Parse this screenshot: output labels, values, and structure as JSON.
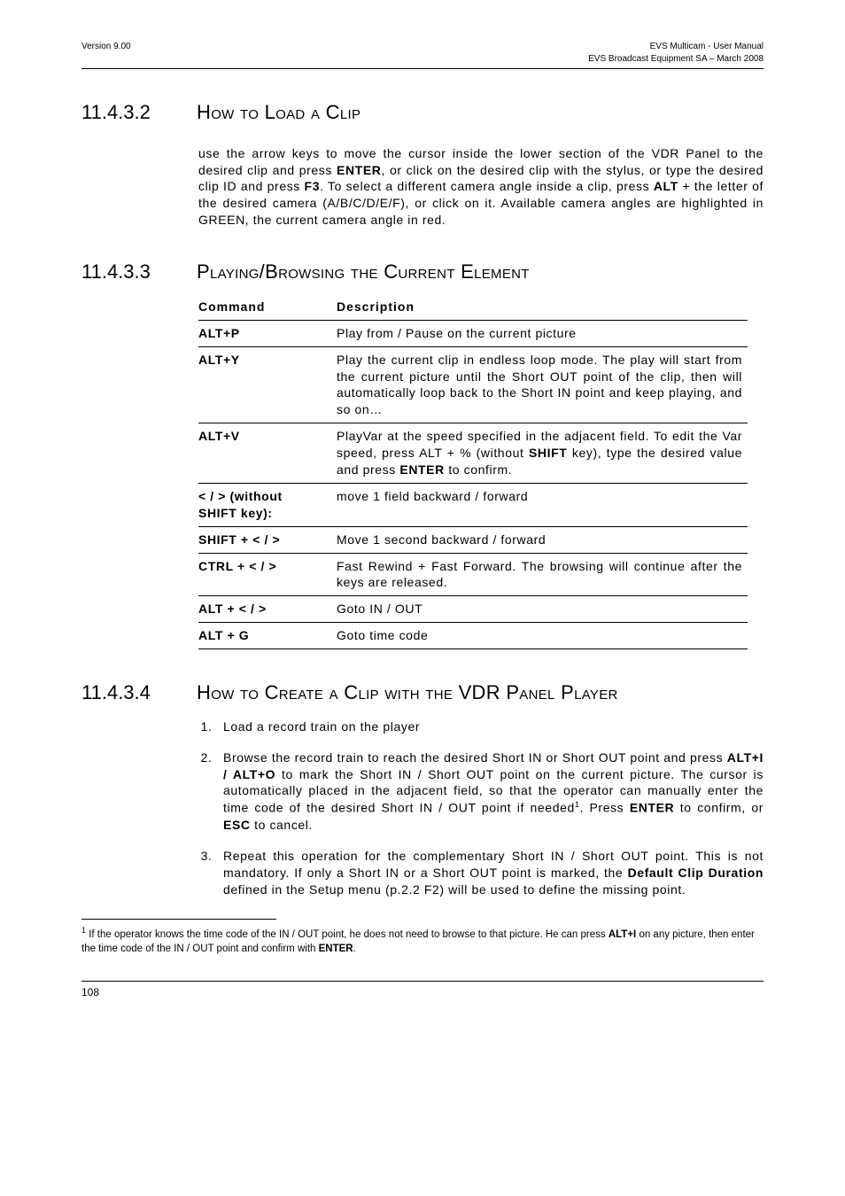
{
  "header": {
    "left": "Version 9.00",
    "right1": "EVS Multicam - User Manual",
    "right2": "EVS Broadcast Equipment SA – March 2008"
  },
  "s1": {
    "num": "11.4.3.2",
    "title": "How to Load a Clip",
    "p1_a": "use the arrow keys to move the cursor inside the lower section of the VDR Panel to the desired clip and press ",
    "p1_b": "ENTER",
    "p1_c": ", or click on the desired clip with the stylus, or type the desired clip ID and press ",
    "p1_d": "F3",
    "p1_e": ". To select a different camera angle inside a clip, press ",
    "p1_f": "ALT",
    "p1_g": " + the letter of the desired camera (A/B/C/D/E/F), or click on it. Available camera angles are highlighted in GREEN, the current camera angle in red."
  },
  "s2": {
    "num": "11.4.3.3",
    "title": "Playing/Browsing the Current Element",
    "th1": "Command",
    "th2": "Description",
    "r1k": "ALT+P",
    "r1v": "Play from / Pause on the current picture",
    "r2k": "ALT+Y",
    "r2v": "Play the current clip in endless loop mode. The play will start from the current picture until the Short OUT point of the clip, then will automatically loop back to the Short IN point and keep playing, and so on…",
    "r3k": "ALT+V",
    "r3v_a": "PlayVar at the speed specified in the adjacent field. To edit the Var speed, press ALT + % (without ",
    "r3v_b": "SHIFT",
    "r3v_c": " key), type the desired value and press ",
    "r3v_d": "ENTER",
    "r3v_e": " to confirm.",
    "r4k": "< / > (without\nSHIFT key):",
    "r4v": "move 1 field backward / forward",
    "r5k": "SHIFT + < / >",
    "r5v": "Move 1 second backward / forward",
    "r6k": "CTRL + < / >",
    "r6v": "Fast Rewind + Fast Forward. The browsing will continue after the keys are released.",
    "r7k": "ALT + < / >",
    "r7v": "Goto IN / OUT",
    "r8k": "ALT + G",
    "r8v": "Goto time code"
  },
  "s3": {
    "num": "11.4.3.4",
    "title": "How to Create a Clip with the VDR Panel Player",
    "li1": "Load a record train on the player",
    "li2_a": "Browse the record train to reach the desired Short IN or Short OUT point and press ",
    "li2_b": "ALT+I / ALT+O",
    "li2_c": " to mark the Short IN / Short OUT point on the current picture. The cursor is automatically placed in the adjacent field, so that the operator can manually enter the time code of the desired Short IN / OUT point if needed",
    "li2_sup": "1",
    "li2_d": ". Press ",
    "li2_e": "ENTER",
    "li2_f": " to confirm, or ",
    "li2_g": "ESC",
    "li2_h": " to cancel.",
    "li3_a": "Repeat this operation for the complementary Short IN / Short OUT point. This is not mandatory. If only a Short IN or a Short OUT point is marked, the ",
    "li3_b": "Default Clip Duration",
    "li3_c": " defined in the Setup menu (p.2.2 F2) will be used to define the missing point."
  },
  "fn": {
    "sup": "1",
    "a": " If the operator knows the time code of the IN / OUT point, he does not need to browse to that picture. He can press ",
    "b": "ALT+I",
    "c": " on any picture, then enter the time code of the IN / OUT point and confirm with ",
    "d": "ENTER",
    "e": "."
  },
  "footer": {
    "page": "108"
  }
}
